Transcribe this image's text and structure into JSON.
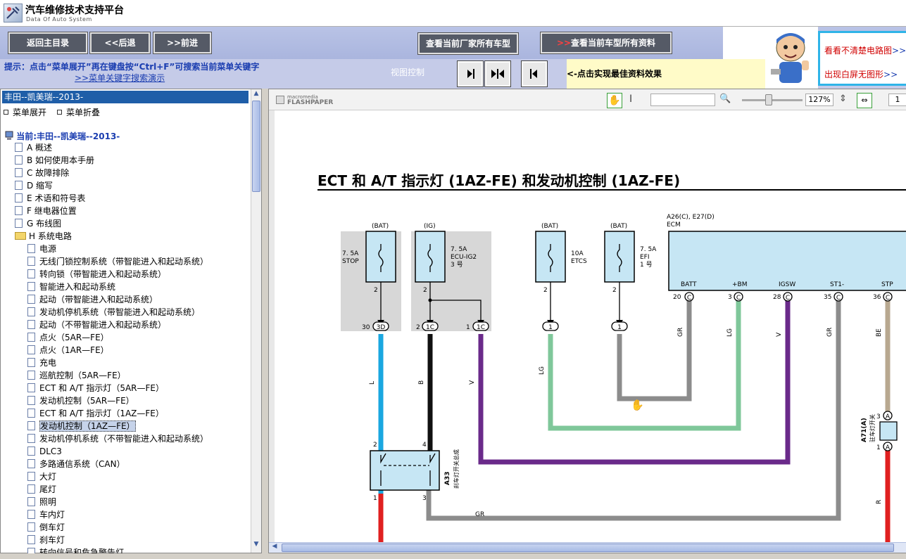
{
  "app": {
    "title": "汽车维修技术支持平台",
    "subtitle": "Data Of Auto System"
  },
  "toolbar": {
    "home_label": "返回主目录",
    "back_label": "<<后退",
    "forward_label": ">>前进",
    "all_models_label": "查看当前厂家所有车型",
    "all_docs_arrows": ">>",
    "all_docs_label": "查看当前车型所有资料"
  },
  "hint": {
    "text": "提示：点击“菜单展开”再在键盘按“Ctrl+F”可搜索当前菜单关键字",
    "link": ">>菜单关键字搜索演示",
    "view_control": "视图控制",
    "tip": "<-点击实现最佳资料效果"
  },
  "ads": {
    "line1": "看看不清楚电路图",
    "line1_link": ">>",
    "line2": "出现白屏无图形",
    "line2_link": ">>"
  },
  "left": {
    "current_car": "丰田--凯美瑞--2013-",
    "expand": "菜单展开",
    "collapse": "菜单折叠",
    "current_label": "当前:丰田--凯美瑞--2013-",
    "items": [
      "A 概述",
      "B 如何使用本手册",
      "C 故障排除",
      "D 缩写",
      "E 术语和符号表",
      "F 继电器位置",
      "G 布线图",
      "H 系统电路",
      "电源",
      "无线门锁控制系统（带智能进入和起动系统）",
      "转向锁（带智能进入和起动系统）",
      "智能进入和起动系统",
      "起动（带智能进入和起动系统）",
      "发动机停机系统（带智能进入和起动系统）",
      "起动（不带智能进入和起动系统）",
      "点火（5AR—FE）",
      "点火（1AR—FE）",
      "充电",
      "巡航控制（5AR—FE）",
      "ECT 和 A/T 指示灯（5AR—FE）",
      "发动机控制（5AR—FE）",
      "ECT 和 A/T 指示灯（1AZ—FE）",
      "发动机控制（1AZ—FE）",
      "发动机停机系统（不带智能进入和起动系统）",
      "DLC3",
      "多路通信系统（CAN）",
      "大灯",
      "尾灯",
      "照明",
      "车内灯",
      "倒车灯",
      "刹车灯",
      "转向信号和危急警告灯"
    ]
  },
  "viewer": {
    "brand_top": "macromedia",
    "brand_bottom": "FLASHPAPER",
    "zoom": "127%",
    "page": "1"
  },
  "diagram": {
    "title": "ECT 和 A/T 指示灯 (1AZ-FE) 和发动机控制 (1AZ-FE)",
    "fuses": [
      {
        "source": "(BAT)",
        "rating": "7. 5A",
        "name": "STOP",
        "pin": "2",
        "conn_pin": "30",
        "conn": "3D",
        "wire": "L"
      },
      {
        "source": "(IG)",
        "rating": "7. 5A",
        "name": "ECU-IG2",
        "extra": "3 号",
        "pin": "2",
        "conn_pin": "2",
        "conn": "1C",
        "wire": "B"
      },
      {
        "source": "(BAT)",
        "rating": "10A",
        "name": "ETCS",
        "pin": "2",
        "conn": "1",
        "wire": "LG"
      },
      {
        "source": "(BAT)",
        "rating": "7. 5A",
        "name": "EFI",
        "extra": "1 号",
        "pin": "2",
        "conn": "1"
      }
    ],
    "ig2_branch": {
      "conn_pin": "1",
      "conn": "1C",
      "wire": "V"
    },
    "ecm": {
      "connector": "A26(C), E27(D)",
      "name": "ECM",
      "pins": [
        {
          "label": "BATT",
          "num": "20",
          "conn": "C",
          "wire": "GR"
        },
        {
          "label": "+BM",
          "num": "3",
          "conn": "C",
          "wire": "LG"
        },
        {
          "label": "IGSW",
          "num": "28",
          "conn": "C",
          "wire": "V"
        },
        {
          "label": "ST1-",
          "num": "35",
          "conn": "C",
          "wire": "GR"
        },
        {
          "label": "STP",
          "num": "36",
          "conn": "C",
          "wire": "BE"
        }
      ]
    },
    "switch": {
      "code": "A33",
      "desc": "刹车灯开关总成",
      "pins": [
        "2",
        "4",
        "1",
        "3"
      ],
      "wire_bottom": "GR"
    },
    "a71": {
      "code": "A71(A)",
      "desc": "驻车灯开关",
      "pins": [
        "3",
        "1"
      ],
      "conn": "A",
      "wire": "R"
    }
  },
  "colors": {
    "accent": "#1f5ea8",
    "hint_blue": "#1a3db0",
    "wire_L": "#1aa7e0",
    "wire_B": "#111111",
    "wire_V": "#6a2a8a",
    "wire_LG": "#7fc79a",
    "wire_GR": "#8c8c8c",
    "wire_BE": "#b8a890",
    "wire_R": "#e02020",
    "ecm_fill": "#c6e6f4"
  }
}
